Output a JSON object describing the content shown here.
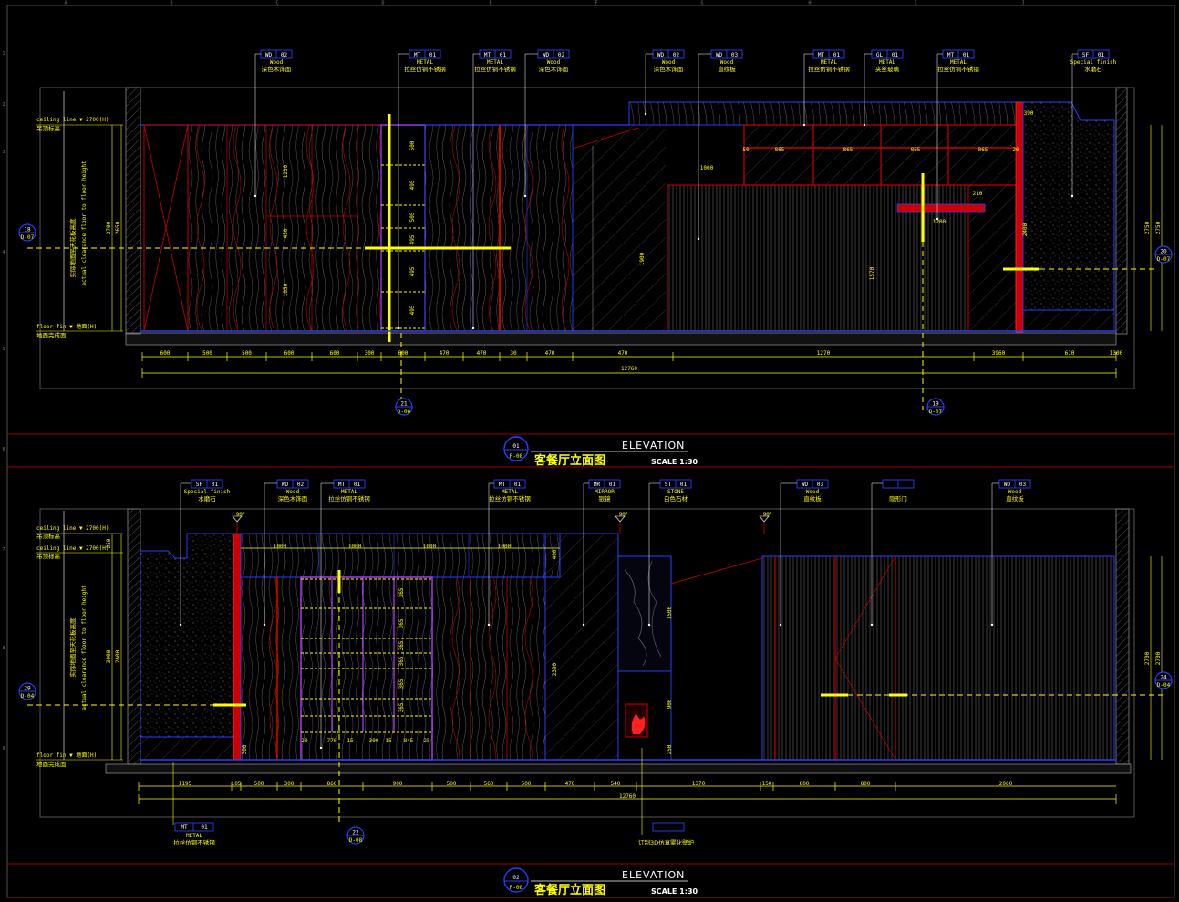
{
  "frame": {
    "col_letters": [
      "A",
      "B",
      "C",
      "D",
      "E",
      "F",
      "G",
      "H",
      "I",
      "J"
    ],
    "row_numbers": [
      "1",
      "2",
      "3",
      "4",
      "5",
      "6",
      "7",
      "8",
      "9"
    ]
  },
  "elevation1": {
    "title_cn": "客餐厅立面图",
    "title_en": "ELEVATION",
    "scale": "SCALE 1:30",
    "bubble_num": "01",
    "bubble_ref": "P-08",
    "ceiling_label": "ceiling line ▼ 2700(H)",
    "ceiling_sub": "吊顶标高",
    "floor_label": "floor fin ▼ 地面(H)",
    "floor_sub": "地面完成面",
    "vertical_note_1": "实际地面至天花板高度",
    "vertical_note_2": "actual clearance floor to floor height",
    "tags": [
      {
        "code": "WD",
        "num": "02",
        "en": "Wood",
        "cn": "深色木饰面"
      },
      {
        "code": "MT",
        "num": "01",
        "en": "METAL",
        "cn": "拉丝仿铜不锈钢"
      },
      {
        "code": "MT",
        "num": "01",
        "en": "METAL",
        "cn": "拉丝仿铜不锈钢"
      },
      {
        "code": "WD",
        "num": "02",
        "en": "Wood",
        "cn": "深色木饰面"
      },
      {
        "code": "WD",
        "num": "02",
        "en": "Wood",
        "cn": "深色木饰面"
      },
      {
        "code": "WD",
        "num": "03",
        "en": "Wood",
        "cn": "直纹板"
      },
      {
        "code": "MT",
        "num": "01",
        "en": "METAL",
        "cn": "拉丝仿铜不锈钢"
      },
      {
        "code": "GL",
        "num": "01",
        "en": "METAL",
        "cn": "夹丝玻璃"
      },
      {
        "code": "MT",
        "num": "01",
        "en": "METAL",
        "cn": "拉丝仿铜不锈钢"
      },
      {
        "code": "SF",
        "num": "01",
        "en": "Special finish",
        "cn": "水磨石"
      }
    ],
    "dims_bottom": [
      "600",
      "500",
      "500",
      "600",
      "600",
      "300",
      "600",
      "470",
      "470",
      "30",
      "470",
      "470",
      "1270",
      "3960",
      "610",
      "1300"
    ],
    "dim_total": "12760",
    "dims_upper": [
      "50",
      "865",
      "865",
      "865",
      "865",
      "20"
    ],
    "dim_misc": [
      "1000",
      "1200",
      "210",
      "390"
    ],
    "dims_left": [
      "2700",
      "2650"
    ],
    "dims_right": [
      "2750",
      "2750"
    ],
    "dims_panel": [
      "1200",
      "450",
      "1050"
    ],
    "dims_shelf": [
      "500",
      "495",
      "505",
      "495",
      "495",
      "495"
    ],
    "dims_vert_misc": [
      "1900",
      "1570",
      "2400"
    ],
    "sections": [
      {
        "num": "18",
        "ref": "D-07"
      },
      {
        "num": "20",
        "ref": "D-07"
      },
      {
        "num": "21",
        "ref": "D-08"
      },
      {
        "num": "19",
        "ref": "D-07"
      }
    ]
  },
  "elevation2": {
    "title_cn": "客餐厅立面图",
    "title_en": "ELEVATION",
    "scale": "SCALE 1:30",
    "bubble_num": "02",
    "bubble_ref": "P-08",
    "ceiling_label": "ceiling line ▼ 2700(H)",
    "ceiling_sub": "吊顶标高",
    "ceiling_label_2": "ceiling line ▼ 2700(H)",
    "ceiling_sub_2": "吊顶标高",
    "floor_label": "floor fin ▼ 地面(H)",
    "floor_sub": "地面完成面",
    "vertical_note_1": "实际地面至天花板高度",
    "vertical_note_2": "actual clearance floor to floor height",
    "tags": [
      {
        "code": "SF",
        "num": "01",
        "en": "Special finish",
        "cn": "水磨石"
      },
      {
        "code": "WD",
        "num": "02",
        "en": "Wood",
        "cn": "深色木饰面"
      },
      {
        "code": "MT",
        "num": "01",
        "en": "METAL",
        "cn": "拉丝仿铜不锈钢"
      },
      {
        "code": "MT",
        "num": "01",
        "en": "METAL",
        "cn": "拉丝仿铜不锈钢"
      },
      {
        "code": "MR",
        "num": "01",
        "en": "MIRROR",
        "cn": "银镜"
      },
      {
        "code": "ST",
        "num": "01",
        "en": "STONE",
        "cn": "白色石材"
      },
      {
        "code": "WD",
        "num": "03",
        "en": "Wood",
        "cn": "直纹板"
      },
      {
        "code": "",
        "num": "",
        "en": "",
        "cn": "隐形门"
      },
      {
        "code": "WD",
        "num": "03",
        "en": "Wood",
        "cn": "直纹板"
      }
    ],
    "tag_bottom_left": {
      "code": "MT",
      "num": "01",
      "en": "METAL",
      "cn": "拉丝仿铜不锈钢"
    },
    "tag_bottom_right": {
      "cn": "订制3D仿真雾化壁炉"
    },
    "dims_top": [
      "1000",
      "1000",
      "1000",
      "1000"
    ],
    "dims_bottom": [
      "1195",
      "105",
      "500",
      "300",
      "860",
      "900",
      "500",
      "560",
      "500",
      "470",
      "540",
      "1370",
      "150",
      "800",
      "800",
      "2060"
    ],
    "dim_total": "12760",
    "dims_left": [
      "3000",
      "2600"
    ],
    "dims_right": [
      "2700",
      "2700"
    ],
    "dims_top_vert": [
      "250",
      "400"
    ],
    "dims_vert_misc": [
      "2390",
      "1500",
      "900",
      "250",
      "300"
    ],
    "dims_shelf": [
      "365",
      "365",
      "365",
      "365",
      "365",
      "365"
    ],
    "dims_shelf_bottom": [
      "20",
      "770",
      "15",
      "300",
      "15",
      "845",
      "25"
    ],
    "angle_marks": [
      "90°",
      "90°",
      "90°"
    ],
    "sections": [
      {
        "num": "29",
        "ref": "D-04"
      },
      {
        "num": "24",
        "ref": "D-04"
      },
      {
        "num": "22",
        "ref": "D-08"
      }
    ]
  }
}
